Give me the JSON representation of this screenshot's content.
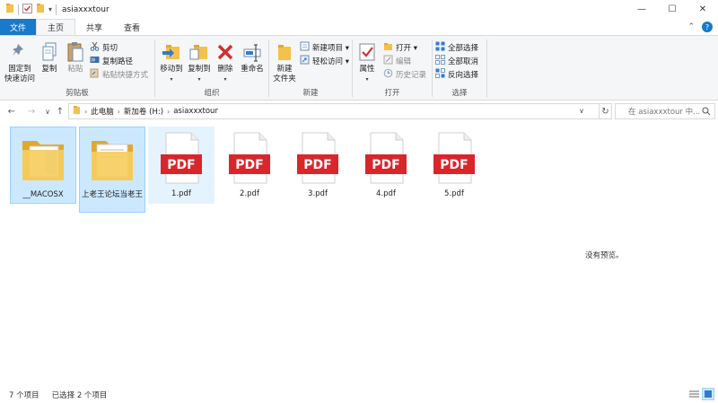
{
  "window": {
    "title": "asiaxxxtour",
    "controls": {
      "minimize": "—",
      "maximize": "☐",
      "close": "✕"
    }
  },
  "tabs": [
    {
      "label": "文件"
    },
    {
      "label": "主页"
    },
    {
      "label": "共享"
    },
    {
      "label": "查看"
    }
  ],
  "ribbon": {
    "clipboard": {
      "label": "剪贴板",
      "pin": "固定到\n快速访问",
      "pin_line1": "固定到",
      "pin_line2": "快速访问",
      "copy": "复制",
      "paste": "粘贴",
      "cut": "剪切",
      "copy_path": "复制路径",
      "paste_shortcut": "粘贴快捷方式"
    },
    "organize": {
      "label": "组织",
      "move_to": "移动到",
      "copy_to": "复制到",
      "delete": "删除",
      "rename": "重命名"
    },
    "new": {
      "label": "新建",
      "new_folder_line1": "新建",
      "new_folder_line2": "文件夹",
      "new_item": "新建项目 ▾",
      "easy_access": "轻松访问 ▾"
    },
    "open": {
      "label": "打开",
      "properties": "属性",
      "open": "打开 ▾",
      "edit": "编辑",
      "history": "历史记录"
    },
    "select": {
      "label": "选择",
      "select_all": "全部选择",
      "select_none": "全部取消",
      "invert": "反向选择"
    }
  },
  "address": {
    "crumbs": [
      "此电脑",
      "新加卷 (H:)",
      "asiaxxxtour"
    ],
    "search_placeholder": "在 asiaxxxtour 中..."
  },
  "files": [
    {
      "name": "__MACOSX",
      "type": "folder",
      "selected": true
    },
    {
      "name": "上老王论坛当老王",
      "type": "folder",
      "selected": true
    },
    {
      "name": "1.pdf",
      "type": "pdf",
      "selected": false,
      "hover": true
    },
    {
      "name": "2.pdf",
      "type": "pdf",
      "selected": false
    },
    {
      "name": "3.pdf",
      "type": "pdf",
      "selected": false
    },
    {
      "name": "4.pdf",
      "type": "pdf",
      "selected": false
    },
    {
      "name": "5.pdf",
      "type": "pdf",
      "selected": false
    }
  ],
  "pdf_badge": "PDF",
  "preview_note": "没有预览。",
  "status": {
    "count": "7 个项目",
    "selected": "已选择 2 个项目"
  },
  "colors": {
    "accent": "#1979ca",
    "selection": "#cce8ff",
    "pdf_red": "#d9262b",
    "folder": "#f3c14c"
  }
}
